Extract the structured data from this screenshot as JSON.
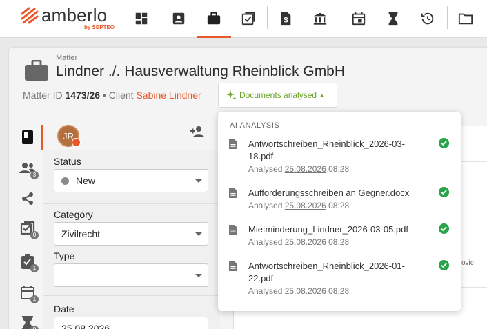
{
  "app": {
    "logo_text": "amberlo",
    "logo_sub": "by SEPTEO",
    "brand_color": "#e8572a"
  },
  "nav": {
    "icons": [
      "dashboard-icon",
      "contacts-icon",
      "matters-icon",
      "tasks-icon",
      "billing-icon",
      "bank-icon",
      "calendar-icon",
      "timer-icon",
      "history-icon",
      "folder-icon"
    ],
    "active": "matters-icon"
  },
  "matter": {
    "label": "Matter",
    "title": "Lindner ./. Hausverwaltung Rheinblick GmbH",
    "id_label": "Matter ID",
    "id_value": "1473/26",
    "separator": "•",
    "client_label": "Client",
    "client_value": "Sabine Lindner",
    "docs_button": "Documents analysed"
  },
  "rail": {
    "badges": [
      "3",
      "0",
      "1",
      "1",
      "0"
    ]
  },
  "form": {
    "avatar_initials": "JR",
    "status_label": "Status",
    "status_value": "New",
    "category_label": "Category",
    "category_value": "Zivilrecht",
    "type_label": "Type",
    "type_value": "",
    "date_label": "Date",
    "date_value": "25.08.2026"
  },
  "background": {
    "peek_text": "ovic"
  },
  "ai_analysis": {
    "title": "AI ANALYSIS",
    "status_color": "#2aa44a",
    "items": [
      {
        "filename": "Antwortschreiben_Rheinblick_2026-03-18.pdf",
        "analysed_label": "Analysed",
        "date": "25.08.2026",
        "time": "08:28"
      },
      {
        "filename": "Aufforderungsschreiben an Gegner.docx",
        "analysed_label": "Analysed",
        "date": "25.08.2026",
        "time": "08:28"
      },
      {
        "filename": "Mietminderung_Lindner_2026-03-05.pdf",
        "analysed_label": "Analysed",
        "date": "25.08.2026",
        "time": "08:28"
      },
      {
        "filename": "Antwortschreiben_Rheinblick_2026-01-22.pdf",
        "analysed_label": "Analysed",
        "date": "25.08.2026",
        "time": "08:28"
      }
    ]
  }
}
